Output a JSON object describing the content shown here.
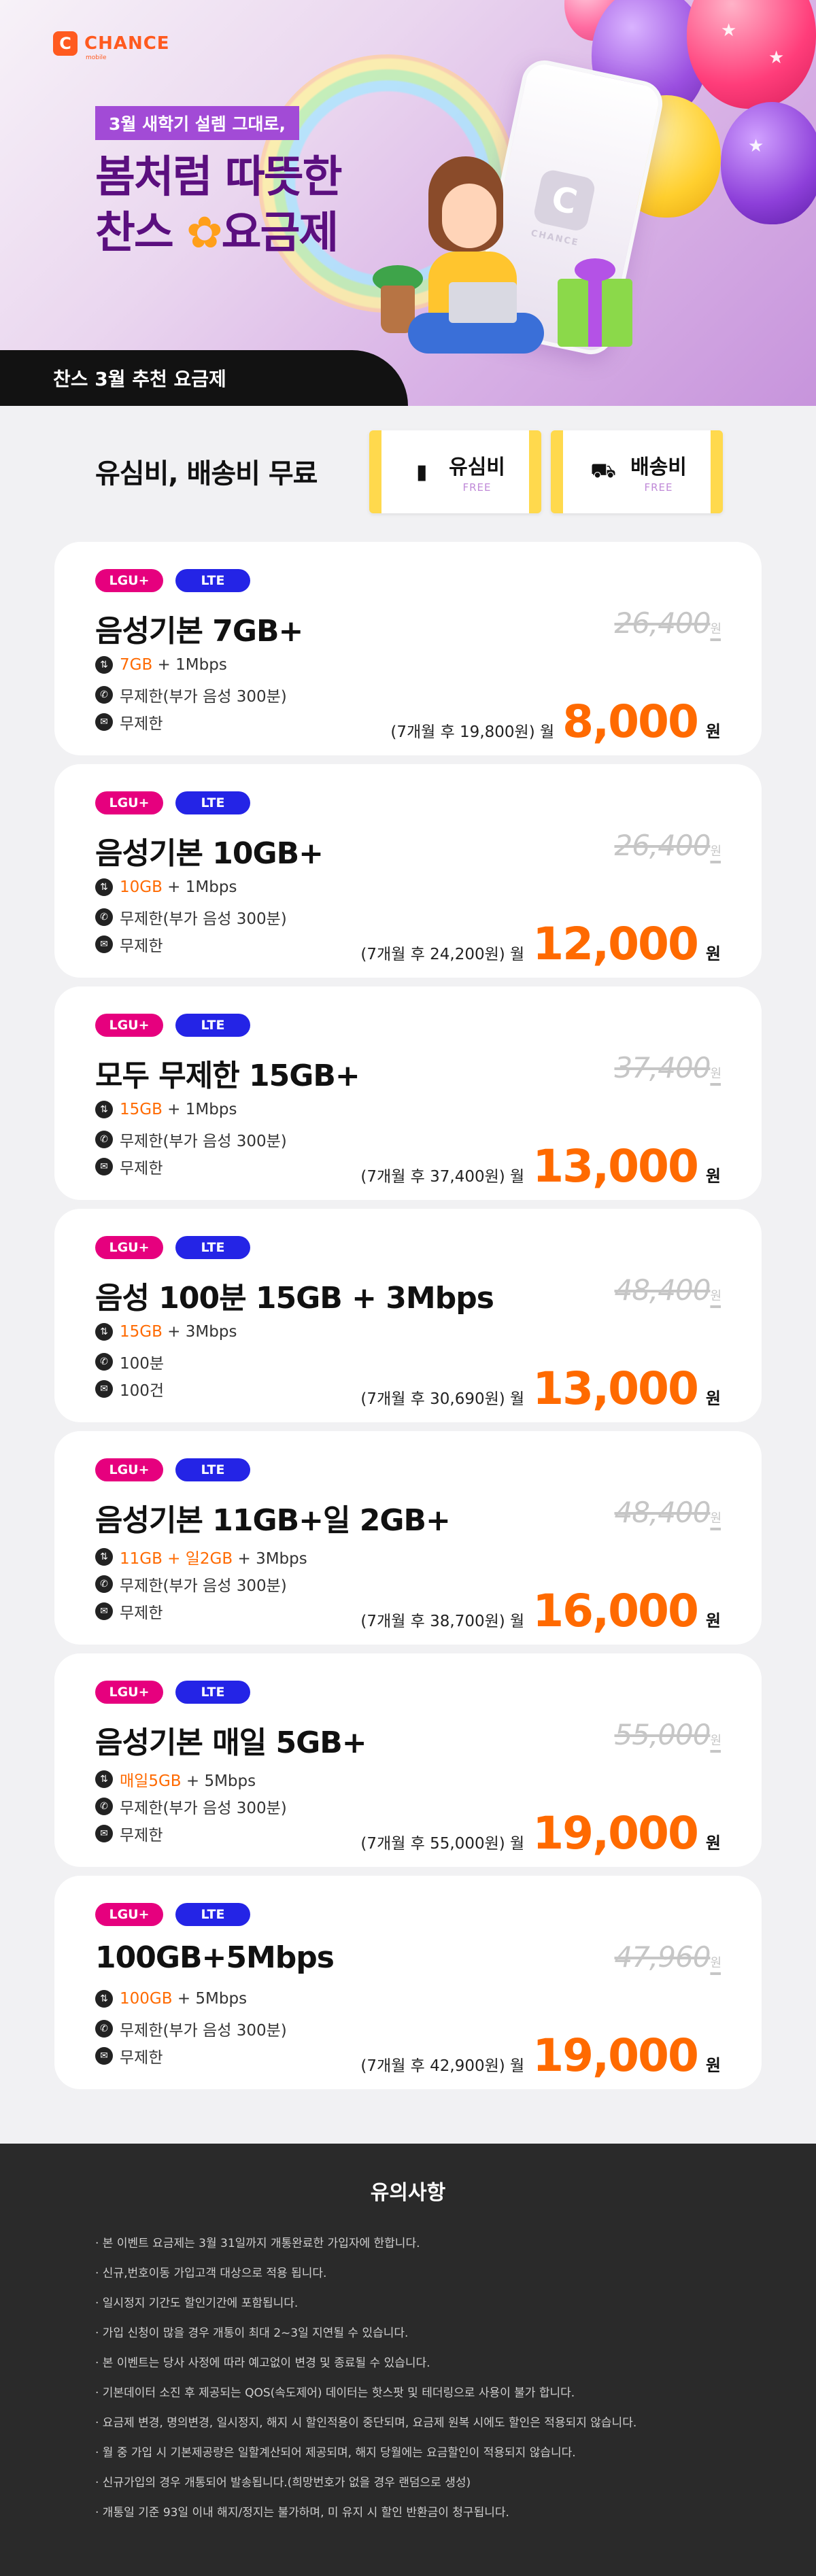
{
  "brand": {
    "logo_letter": "C",
    "name": "CHANCE",
    "sub": "mobile"
  },
  "hero": {
    "tagline": "3월 새학기 설렘 그대로,",
    "title_line1": "봄처럼 따뜻한",
    "title_line2_a": "찬스 ",
    "title_line2_flower": "✿",
    "title_line2_b": "요금제",
    "phone_letter": "C",
    "phone_text": "CHANCE",
    "ribbon": "찬스 3월 추천 요금제"
  },
  "free": {
    "title": "유심비, 배송비 무료",
    "tickets": [
      {
        "icon": "sim-card-icon",
        "label": "유심비",
        "sub": "FREE"
      },
      {
        "icon": "delivery-truck-icon",
        "label": "배송비",
        "sub": "FREE"
      }
    ]
  },
  "colors": {
    "accent": "#ff6a00",
    "lgu": "#e6007e",
    "lte": "#2424e6",
    "hero_purple": "#5b0f7f"
  },
  "plans": [
    {
      "carrier": "LGU+",
      "network": "LTE",
      "name": "음성기본 7GB+",
      "original": "26,400",
      "orig_unit": "원",
      "data_hl": "7GB",
      "data_rest": " + 1Mbps",
      "voice": "무제한(부가 음성 300분)",
      "sms": "무제한",
      "after": "(7개월 후 19,800원) 월",
      "price": "8,000",
      "unit": "원"
    },
    {
      "carrier": "LGU+",
      "network": "LTE",
      "name": "음성기본 10GB+",
      "original": "26,400",
      "orig_unit": "원",
      "data_hl": "10GB",
      "data_rest": " + 1Mbps",
      "voice": "무제한(부가 음성 300분)",
      "sms": "무제한",
      "after": "(7개월 후 24,200원) 월",
      "price": "12,000",
      "unit": "원"
    },
    {
      "carrier": "LGU+",
      "network": "LTE",
      "name": "모두 무제한 15GB+",
      "original": "37,400",
      "orig_unit": "원",
      "data_hl": "15GB",
      "data_rest": " + 1Mbps",
      "voice": "무제한(부가 음성 300분)",
      "sms": "무제한",
      "after": "(7개월 후 37,400원) 월",
      "price": "13,000",
      "unit": "원"
    },
    {
      "carrier": "LGU+",
      "network": "LTE",
      "name": "음성 100분 15GB + 3Mbps",
      "original": "48,400",
      "orig_unit": "원",
      "data_hl": "15GB",
      "data_rest": " + 3Mbps",
      "voice": "100분",
      "sms": "100건",
      "after": "(7개월 후 30,690원) 월",
      "price": "13,000",
      "unit": "원"
    },
    {
      "carrier": "LGU+",
      "network": "LTE",
      "name": "음성기본 11GB+일 2GB+",
      "original": "48,400",
      "orig_unit": "원",
      "data_hl": "11GB + 일2GB",
      "data_rest": " + 3Mbps",
      "voice": "무제한(부가 음성 300분)",
      "sms": "무제한",
      "after": "(7개월 후 38,700원) 월",
      "price": "16,000",
      "unit": "원"
    },
    {
      "carrier": "LGU+",
      "network": "LTE",
      "name": "음성기본 매일 5GB+",
      "original": "55,000",
      "orig_unit": "원",
      "data_hl": "매일5GB",
      "data_rest": " + 5Mbps",
      "voice": "무제한(부가 음성 300분)",
      "sms": "무제한",
      "after": "(7개월 후 55,000원) 월",
      "price": "19,000",
      "unit": "원"
    },
    {
      "carrier": "LGU+",
      "network": "LTE",
      "name": "100GB+5Mbps",
      "original": "47,960",
      "orig_unit": "원",
      "data_hl": "100GB",
      "data_rest": " + 5Mbps",
      "voice": "무제한(부가 음성 300분)",
      "sms": "무제한",
      "after": "(7개월 후 42,900원) 월",
      "price": "19,000",
      "unit": "원"
    }
  ],
  "notice": {
    "title": "유의사항",
    "items": [
      "· 본 이벤트 요금제는 3월 31일까지 개통완료한 가입자에 한합니다.",
      "· 신규,번호이동 가입고객 대상으로 적용 됩니다.",
      "· 일시정지 기간도 할인기간에 포함됩니다.",
      "· 가입 신청이 많을 경우 개통이 최대 2~3일 지연될 수 있습니다.",
      "· 본 이벤트는 당사 사정에 따라 예고없이 변경 및 종료될 수 있습니다.",
      "· 기본데이터 소진 후 제공되는 QOS(속도제어) 데이터는 핫스팟 및 테더링으로 사용이 불가 합니다.",
      "· 요금제 변경, 명의변경, 일시정지, 해지 시 할인적용이 중단되며, 요금제 원복 시에도 할인은 적용되지 않습니다.",
      "· 월 중 가입 시 기본제공량은 일할계산되어 제공되며, 해지 당월에는 요금할인이 적용되지 않습니다.",
      "· 신규가입의 경우 개통되어 발송됩니다.(희망번호가 없을 경우 랜덤으로 생성)",
      "· 개통일 기준 93일 이내 해지/정지는 불가하며, 미 유지 시 할인 반환금이 청구됩니다."
    ]
  }
}
